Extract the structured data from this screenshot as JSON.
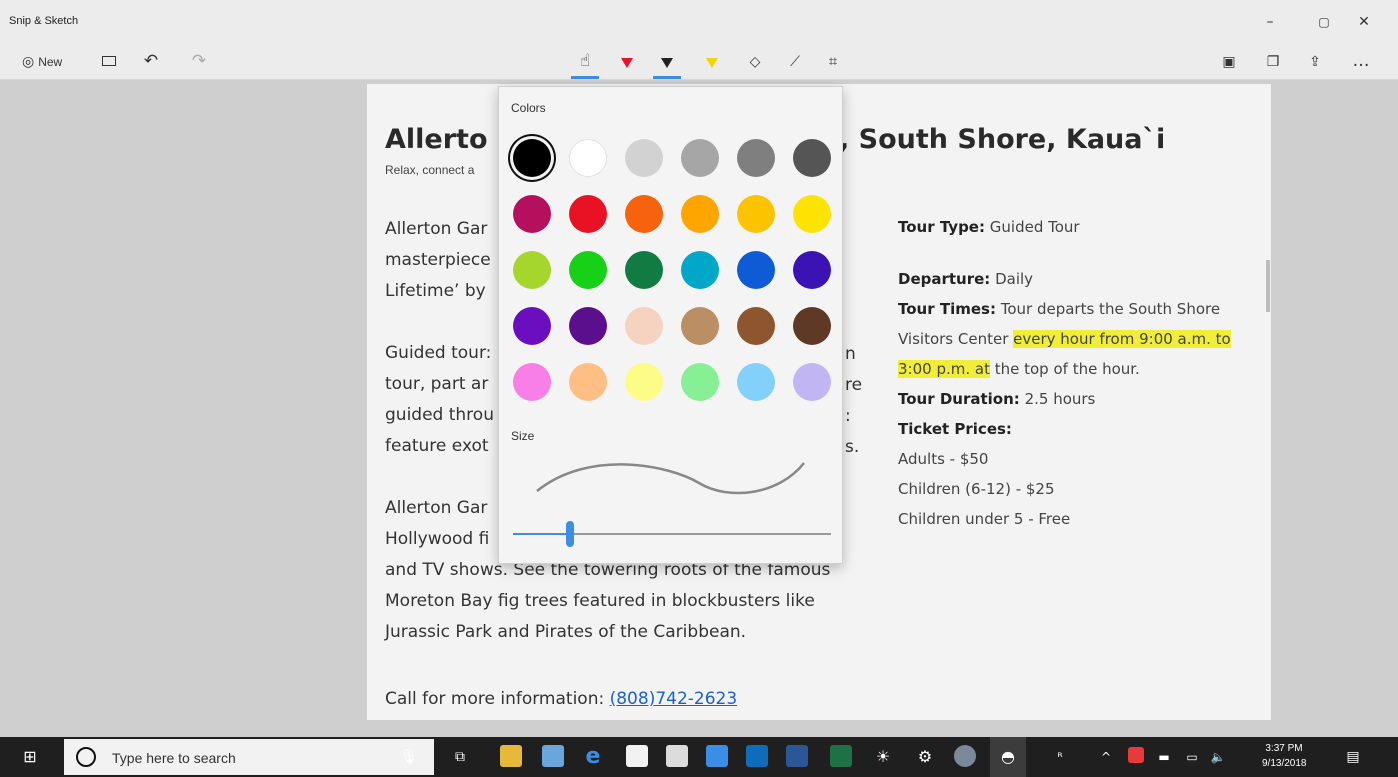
{
  "app": {
    "title": "Snip & Sketch"
  },
  "window": {
    "minimize": "–",
    "maximize": "▢",
    "close": "✕"
  },
  "toolbar": {
    "new_label": "New",
    "more": "…"
  },
  "flyout": {
    "colors_label": "Colors",
    "size_label": "Size",
    "selected_color": "#000000",
    "swatches": [
      "#000000",
      "#ffffff",
      "#d2d2d2",
      "#a6a6a6",
      "#7f7f7f",
      "#555555",
      "#b5105e",
      "#e81224",
      "#f7630c",
      "#ffa500",
      "#fcc400",
      "#fde400",
      "#a4d62c",
      "#16d115",
      "#107c41",
      "#00a7c8",
      "#0f5bd6",
      "#3b13b5",
      "#6b0ebf",
      "#5c0f8c",
      "#f6d3c0",
      "#bb8e63",
      "#8e562e",
      "#5e3a26",
      "#f97fe8",
      "#ffbf84",
      "#fdfc87",
      "#87ef94",
      "#83d0fa",
      "#c2b5f4"
    ],
    "size_value": 0.18
  },
  "document": {
    "title_left": "Allerto",
    "title_right": ", South Shore, Kaua`i",
    "subtitle": "Relax, connect a",
    "para1": [
      "Allerton Gar",
      "masterpiece",
      "Lifetime’  by"
    ],
    "para2": [
      "Guided tour:",
      "tour, part ar",
      "guided throu",
      "feature exot"
    ],
    "para2_tails": [
      "n",
      "re",
      ":",
      "s."
    ],
    "para3": [
      "Allerton Gar",
      "Hollywood fi"
    ],
    "para3_full": [
      "and TV shows. See the towering roots of the famous",
      "Moreton Bay fig trees featured in blockbusters like",
      "Jurassic Park and Pirates of the Caribbean."
    ],
    "call_label": "Call for more information:",
    "phone": "(808)742-2623",
    "info": {
      "tour_type_label": "Tour Type:",
      "tour_type": "Guided Tour",
      "departure_label": "Departure:",
      "departure": "Daily",
      "times_label": "Tour Times:",
      "times_1": "Tour departs the South Shore",
      "times_2a": "Visitors Center ",
      "times_2b": "every hour from 9:00 a.m. to",
      "times_3a": "3:00 p.m. at",
      "times_3b": " the top of the hour.",
      "duration_label": "Tour Duration:",
      "duration": "2.5 hours",
      "prices_label": "Ticket Prices:",
      "price_1": "Adults - $50",
      "price_2": "Children (6-12) - $25",
      "price_3": "Children under 5 - Free"
    }
  },
  "taskbar": {
    "search_placeholder": "Type here to search",
    "time": "3:37 PM",
    "date": "9/13/2018"
  }
}
